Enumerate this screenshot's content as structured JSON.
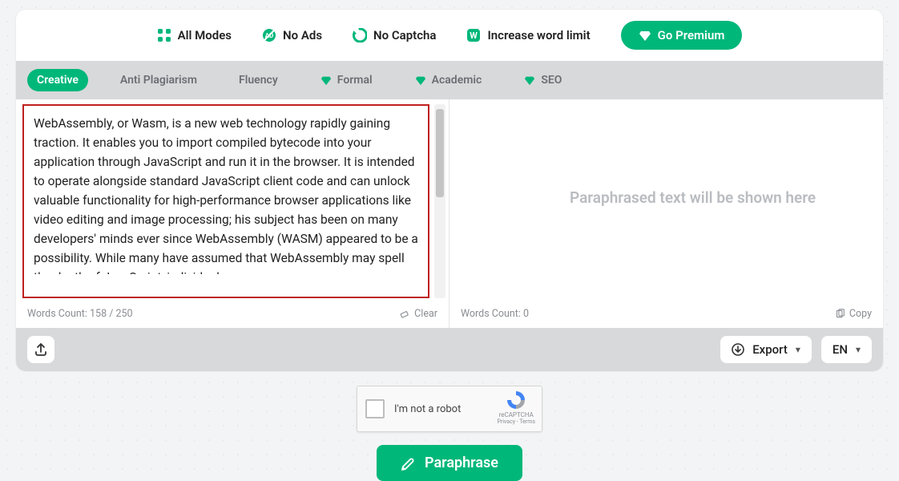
{
  "topbar": {
    "all_modes": "All Modes",
    "no_ads": "No Ads",
    "no_captcha": "No Captcha",
    "word_limit": "Increase word limit",
    "premium": "Go Premium"
  },
  "tabs": {
    "creative": "Creative",
    "anti_plagiarism": "Anti Plagiarism",
    "fluency": "Fluency",
    "formal": "Formal",
    "academic": "Academic",
    "seo": "SEO"
  },
  "input": {
    "text": "WebAssembly, or Wasm, is a new web technology rapidly gaining traction. It enables you to import compiled bytecode into your application through JavaScript and run it in the browser. It is intended to operate alongside standard JavaScript client code and can unlock valuable functionality for high-performance browser applications like video editing and image processing; his subject has been on many developers' minds ever since WebAssembly (WASM) appeared to be a possibility. While many have assumed that WebAssembly may spell the death of JavaScript, individuals",
    "word_count_label": "Words Count: 158 / 250",
    "clear": "Clear"
  },
  "output": {
    "placeholder": "Paraphrased text will be shown here",
    "word_count_label": "Words Count: 0",
    "copy": "Copy"
  },
  "controls": {
    "export": "Export",
    "lang": "EN"
  },
  "recaptcha": {
    "label": "I'm not a robot",
    "brand": "reCAPTCHA",
    "small": "Privacy - Terms"
  },
  "action": {
    "paraphrase": "Paraphrase"
  }
}
